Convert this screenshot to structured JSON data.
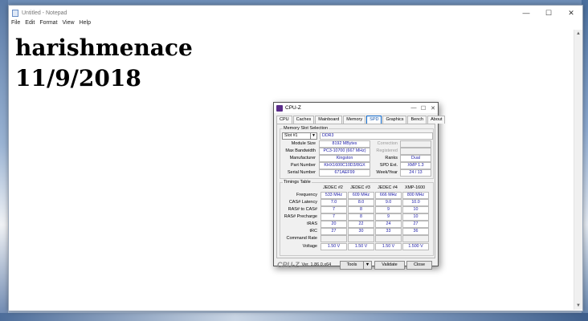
{
  "notepad": {
    "title": "Untitled - Notepad",
    "controls": [
      "—",
      "☐",
      "✕"
    ],
    "menu": [
      "File",
      "Edit",
      "Format",
      "View",
      "Help"
    ],
    "text": "harishmenace\n11/9/2018"
  },
  "cpuz": {
    "title": "CPU-Z",
    "controls": [
      "—",
      "☐",
      "✕"
    ],
    "tabs": [
      "CPU",
      "Caches",
      "Mainboard",
      "Memory",
      "SPD",
      "Graphics",
      "Bench",
      "About"
    ],
    "active_tab": "SPD",
    "memory_slot_selection": {
      "label": "Memory Slot Selection",
      "slot": "Slot #1",
      "type": "DDR3",
      "module_size_label": "Module Size",
      "module_size": "8192 MBytes",
      "max_bandwidth_label": "Max Bandwidth",
      "max_bandwidth": "PC3-10700 (667 MHz)",
      "manufacturer_label": "Manufacturer",
      "manufacturer": "Kingston",
      "part_number_label": "Part Number",
      "part_number": "KHX1600C10D3/8GX",
      "serial_number_label": "Serial Number",
      "serial_number": "671AEF99",
      "correction_label": "Correction",
      "correction": "",
      "registered_label": "Registered",
      "registered": "",
      "ranks_label": "Ranks",
      "ranks": "Dual",
      "spd_ext_label": "SPD Ext.",
      "spd_ext": "XMP 1.3",
      "week_year_label": "Week/Year",
      "week_year": "24 / 13"
    },
    "timings": {
      "label": "Timings Table",
      "columns": [
        "JEDEC #2",
        "JEDEC #3",
        "JEDEC #4",
        "XMP-1600"
      ],
      "rows": [
        {
          "label": "Frequency",
          "values": [
            "533 MHz",
            "609 MHz",
            "666 MHz",
            "800 MHz"
          ]
        },
        {
          "label": "CAS# Latency",
          "values": [
            "7.0",
            "8.0",
            "9.0",
            "10.0"
          ]
        },
        {
          "label": "RAS# to CAS#",
          "values": [
            "7",
            "8",
            "9",
            "10"
          ]
        },
        {
          "label": "RAS# Precharge",
          "values": [
            "7",
            "8",
            "9",
            "10"
          ]
        },
        {
          "label": "tRAS",
          "values": [
            "20",
            "22",
            "24",
            "27"
          ]
        },
        {
          "label": "tRC",
          "values": [
            "27",
            "30",
            "33",
            "36"
          ]
        },
        {
          "label": "Command Rate",
          "values": [
            "",
            "",
            "",
            ""
          ]
        },
        {
          "label": "Voltage",
          "values": [
            "1.50 V",
            "1.50 V",
            "1.50 V",
            "1.500 V"
          ]
        }
      ]
    },
    "footer": {
      "brand": "CPU-Z",
      "version": "Ver. 1.86.0.x64",
      "tools_label": "Tools",
      "validate_label": "Validate",
      "close_label": "Close"
    }
  }
}
